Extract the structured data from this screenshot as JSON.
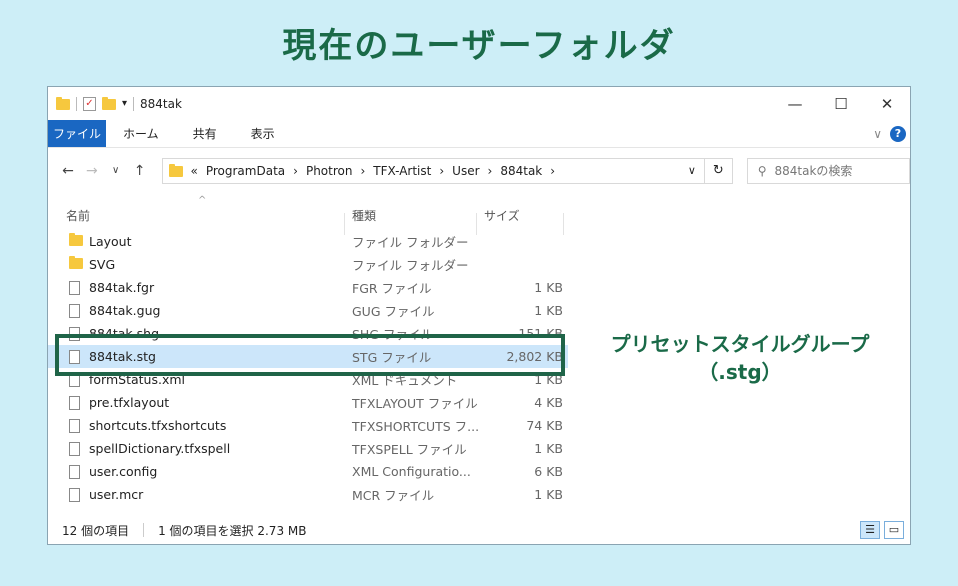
{
  "heading": "現在のユーザーフォルダ",
  "window": {
    "title": "884tak",
    "controls": {
      "minimize": "—",
      "maximize": "☐",
      "close": "✕"
    }
  },
  "ribbon": {
    "file": "ファイル",
    "tabs": [
      "ホーム",
      "共有",
      "表示"
    ],
    "expand": "∨",
    "help": "?"
  },
  "nav": {
    "back": "←",
    "forward": "→",
    "recent": "∨",
    "up": "↑",
    "address_prefix": "«",
    "breadcrumb": [
      "ProgramData",
      "Photron",
      "TFX-Artist",
      "User",
      "884tak"
    ],
    "sep": "›",
    "dropdown": "∨",
    "refresh": "↻",
    "search_placeholder": "884takの検索"
  },
  "columns": {
    "name": "名前",
    "type": "種類",
    "size": "サイズ",
    "sort": "^"
  },
  "files": [
    {
      "name": "Layout",
      "type": "ファイル フォルダー",
      "size": "",
      "kind": "folder"
    },
    {
      "name": "SVG",
      "type": "ファイル フォルダー",
      "size": "",
      "kind": "folder"
    },
    {
      "name": "884tak.fgr",
      "type": "FGR ファイル",
      "size": "1 KB",
      "kind": "file"
    },
    {
      "name": "884tak.gug",
      "type": "GUG ファイル",
      "size": "1 KB",
      "kind": "file"
    },
    {
      "name": "884tak.shg",
      "type": "SHG ファイル",
      "size": "151 KB",
      "kind": "file"
    },
    {
      "name": "884tak.stg",
      "type": "STG ファイル",
      "size": "2,802 KB",
      "kind": "file"
    },
    {
      "name": "formStatus.xml",
      "type": "XML ドキュメント",
      "size": "1 KB",
      "kind": "file"
    },
    {
      "name": "pre.tfxlayout",
      "type": "TFXLAYOUT ファイル",
      "size": "4 KB",
      "kind": "file"
    },
    {
      "name": "shortcuts.tfxshortcuts",
      "type": "TFXSHORTCUTS フ...",
      "size": "74 KB",
      "kind": "file"
    },
    {
      "name": "spellDictionary.tfxspell",
      "type": "TFXSPELL ファイル",
      "size": "1 KB",
      "kind": "file"
    },
    {
      "name": "user.config",
      "type": "XML Configuratio...",
      "size": "6 KB",
      "kind": "file"
    },
    {
      "name": "user.mcr",
      "type": "MCR ファイル",
      "size": "1 KB",
      "kind": "file"
    }
  ],
  "selected_index": 5,
  "status": {
    "count": "12 個の項目",
    "selection": "1 個の項目を選択  2.73 MB"
  },
  "callout": {
    "line1": "プリセットスタイルグループ",
    "line2": "（.stg）"
  },
  "colors": {
    "accent": "#1a67c2",
    "highlight": "#1f6448",
    "heading": "#1a6a48",
    "background": "#cdeef7"
  }
}
